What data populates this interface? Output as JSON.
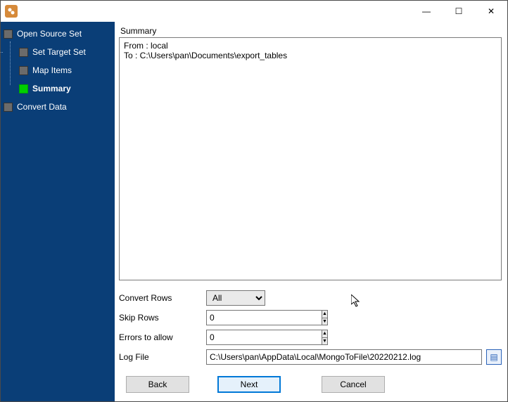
{
  "window": {
    "minimize": "—",
    "maximize": "☐",
    "close": "✕"
  },
  "sidebar": {
    "root": "Open Source Set",
    "children": [
      "Set Target Set",
      "Map Items",
      "Summary"
    ],
    "last": "Convert Data"
  },
  "summary": {
    "heading": "Summary",
    "body": "From : local\nTo : C:\\Users\\pan\\Documents\\export_tables"
  },
  "form": {
    "convert_rows_label": "Convert Rows",
    "convert_rows_value": "All",
    "skip_rows_label": "Skip Rows",
    "skip_rows_value": "0",
    "errors_label": "Errors to allow",
    "errors_value": "0",
    "log_label": "Log File",
    "log_value": "C:\\Users\\pan\\AppData\\Local\\MongoToFile\\20220212.log"
  },
  "buttons": {
    "back": "Back",
    "next": "Next",
    "cancel": "Cancel"
  }
}
